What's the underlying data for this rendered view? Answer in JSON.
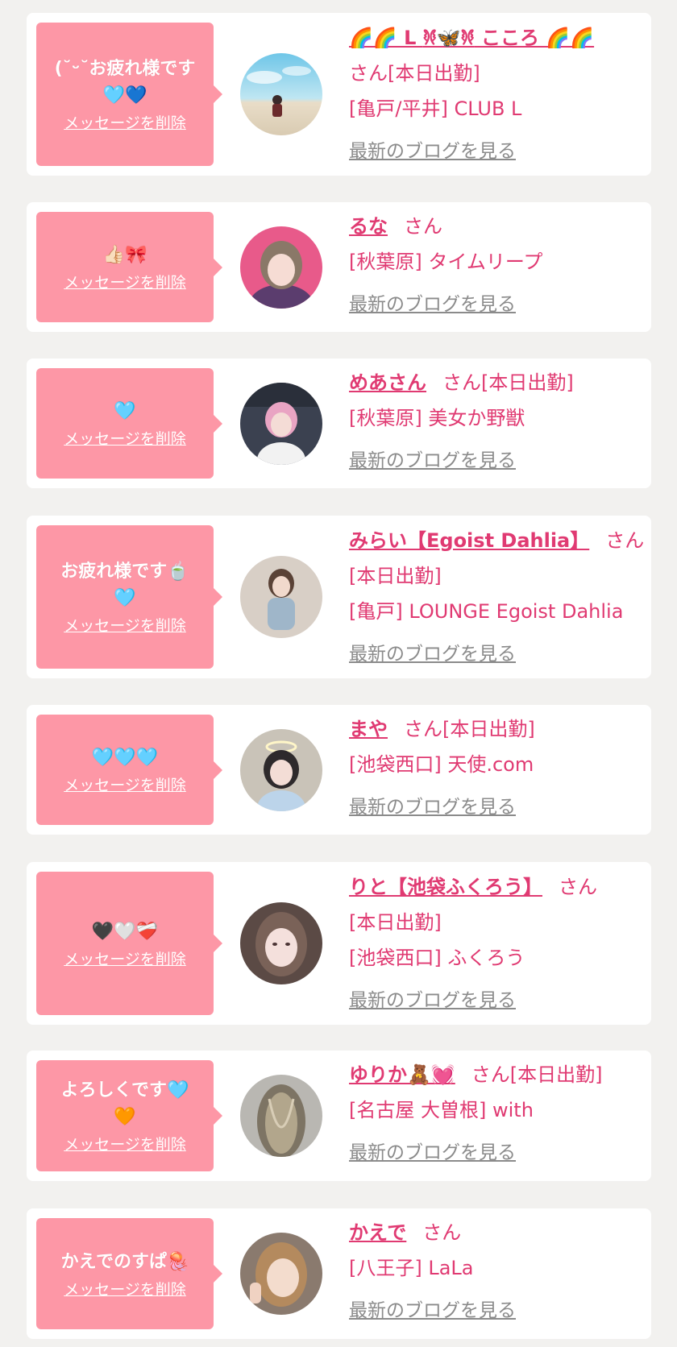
{
  "delete_label": "メッセージを削除",
  "blog_label": "最新のブログを見る",
  "colors": {
    "bubble": "#fd97a6",
    "accent": "#e03a72",
    "muted": "#8b8b8b",
    "background": "#f2f1ef"
  },
  "cards": [
    {
      "message": "(˘ᵕ˘お疲れ様です\n🩵💙",
      "name": "🌈🌈 L 𐦍🦋𐦍 こころ 🌈🌈",
      "suffix": "さん[本日出勤]",
      "shop": "[亀戸/平井] CLUB L"
    },
    {
      "message": "👍🏻🎀",
      "name": "るな",
      "suffix": "さん",
      "shop": "[秋葉原] タイムリープ"
    },
    {
      "message": "🩵",
      "name": "めあさん",
      "suffix": "さん[本日出勤]",
      "shop": "[秋葉原] 美女か野獣"
    },
    {
      "message": "お疲れ様です🍵\n🩵",
      "name": "みらい【Egoist Dahlia】",
      "suffix": "さん",
      "status": "[本日出勤]",
      "shop": "[亀戸] LOUNGE Egoist Dahlia"
    },
    {
      "message": "🩵🩵🩵",
      "name": "まや",
      "suffix": "さん[本日出勤]",
      "shop": "[池袋西口] 天使.com"
    },
    {
      "message": "🖤🤍❤️‍🩹",
      "name": "りと【池袋ふくろう】",
      "suffix": "さん",
      "status": "[本日出勤]",
      "shop": "[池袋西口] ふくろう"
    },
    {
      "message": "よろしくです🩵\n🧡",
      "name": "ゆりか🧸💓",
      "suffix": "さん[本日出勤]",
      "shop": "[名古屋 大曽根] with"
    },
    {
      "message": "かえでのすぱ🪼",
      "name": "かえで",
      "suffix": "さん",
      "shop": "[八王子] LaLa"
    }
  ]
}
